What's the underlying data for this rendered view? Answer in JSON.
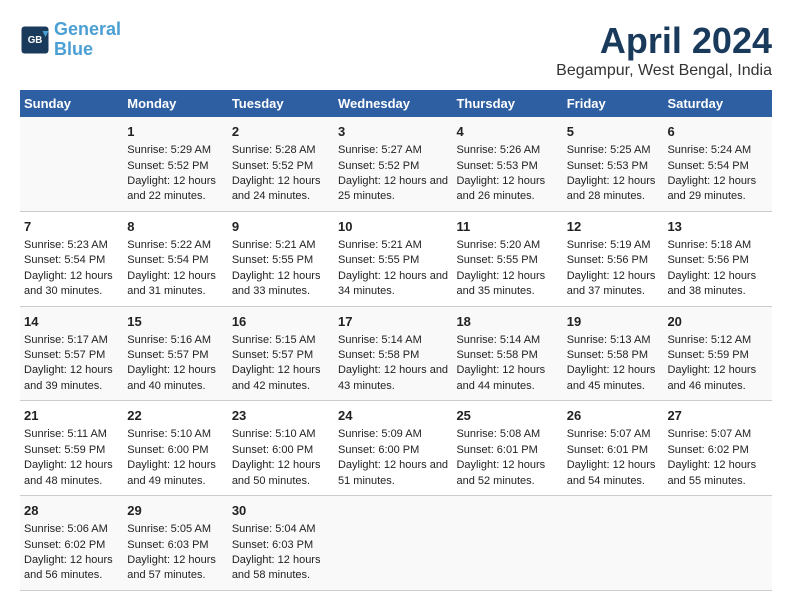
{
  "header": {
    "logo_line1": "General",
    "logo_line2": "Blue",
    "title": "April 2024",
    "subtitle": "Begampur, West Bengal, India"
  },
  "columns": [
    "Sunday",
    "Monday",
    "Tuesday",
    "Wednesday",
    "Thursday",
    "Friday",
    "Saturday"
  ],
  "weeks": [
    [
      {
        "day": "",
        "sunrise": "",
        "sunset": "",
        "daylight": ""
      },
      {
        "day": "1",
        "sunrise": "Sunrise: 5:29 AM",
        "sunset": "Sunset: 5:52 PM",
        "daylight": "Daylight: 12 hours and 22 minutes."
      },
      {
        "day": "2",
        "sunrise": "Sunrise: 5:28 AM",
        "sunset": "Sunset: 5:52 PM",
        "daylight": "Daylight: 12 hours and 24 minutes."
      },
      {
        "day": "3",
        "sunrise": "Sunrise: 5:27 AM",
        "sunset": "Sunset: 5:52 PM",
        "daylight": "Daylight: 12 hours and 25 minutes."
      },
      {
        "day": "4",
        "sunrise": "Sunrise: 5:26 AM",
        "sunset": "Sunset: 5:53 PM",
        "daylight": "Daylight: 12 hours and 26 minutes."
      },
      {
        "day": "5",
        "sunrise": "Sunrise: 5:25 AM",
        "sunset": "Sunset: 5:53 PM",
        "daylight": "Daylight: 12 hours and 28 minutes."
      },
      {
        "day": "6",
        "sunrise": "Sunrise: 5:24 AM",
        "sunset": "Sunset: 5:54 PM",
        "daylight": "Daylight: 12 hours and 29 minutes."
      }
    ],
    [
      {
        "day": "7",
        "sunrise": "Sunrise: 5:23 AM",
        "sunset": "Sunset: 5:54 PM",
        "daylight": "Daylight: 12 hours and 30 minutes."
      },
      {
        "day": "8",
        "sunrise": "Sunrise: 5:22 AM",
        "sunset": "Sunset: 5:54 PM",
        "daylight": "Daylight: 12 hours and 31 minutes."
      },
      {
        "day": "9",
        "sunrise": "Sunrise: 5:21 AM",
        "sunset": "Sunset: 5:55 PM",
        "daylight": "Daylight: 12 hours and 33 minutes."
      },
      {
        "day": "10",
        "sunrise": "Sunrise: 5:21 AM",
        "sunset": "Sunset: 5:55 PM",
        "daylight": "Daylight: 12 hours and 34 minutes."
      },
      {
        "day": "11",
        "sunrise": "Sunrise: 5:20 AM",
        "sunset": "Sunset: 5:55 PM",
        "daylight": "Daylight: 12 hours and 35 minutes."
      },
      {
        "day": "12",
        "sunrise": "Sunrise: 5:19 AM",
        "sunset": "Sunset: 5:56 PM",
        "daylight": "Daylight: 12 hours and 37 minutes."
      },
      {
        "day": "13",
        "sunrise": "Sunrise: 5:18 AM",
        "sunset": "Sunset: 5:56 PM",
        "daylight": "Daylight: 12 hours and 38 minutes."
      }
    ],
    [
      {
        "day": "14",
        "sunrise": "Sunrise: 5:17 AM",
        "sunset": "Sunset: 5:57 PM",
        "daylight": "Daylight: 12 hours and 39 minutes."
      },
      {
        "day": "15",
        "sunrise": "Sunrise: 5:16 AM",
        "sunset": "Sunset: 5:57 PM",
        "daylight": "Daylight: 12 hours and 40 minutes."
      },
      {
        "day": "16",
        "sunrise": "Sunrise: 5:15 AM",
        "sunset": "Sunset: 5:57 PM",
        "daylight": "Daylight: 12 hours and 42 minutes."
      },
      {
        "day": "17",
        "sunrise": "Sunrise: 5:14 AM",
        "sunset": "Sunset: 5:58 PM",
        "daylight": "Daylight: 12 hours and 43 minutes."
      },
      {
        "day": "18",
        "sunrise": "Sunrise: 5:14 AM",
        "sunset": "Sunset: 5:58 PM",
        "daylight": "Daylight: 12 hours and 44 minutes."
      },
      {
        "day": "19",
        "sunrise": "Sunrise: 5:13 AM",
        "sunset": "Sunset: 5:58 PM",
        "daylight": "Daylight: 12 hours and 45 minutes."
      },
      {
        "day": "20",
        "sunrise": "Sunrise: 5:12 AM",
        "sunset": "Sunset: 5:59 PM",
        "daylight": "Daylight: 12 hours and 46 minutes."
      }
    ],
    [
      {
        "day": "21",
        "sunrise": "Sunrise: 5:11 AM",
        "sunset": "Sunset: 5:59 PM",
        "daylight": "Daylight: 12 hours and 48 minutes."
      },
      {
        "day": "22",
        "sunrise": "Sunrise: 5:10 AM",
        "sunset": "Sunset: 6:00 PM",
        "daylight": "Daylight: 12 hours and 49 minutes."
      },
      {
        "day": "23",
        "sunrise": "Sunrise: 5:10 AM",
        "sunset": "Sunset: 6:00 PM",
        "daylight": "Daylight: 12 hours and 50 minutes."
      },
      {
        "day": "24",
        "sunrise": "Sunrise: 5:09 AM",
        "sunset": "Sunset: 6:00 PM",
        "daylight": "Daylight: 12 hours and 51 minutes."
      },
      {
        "day": "25",
        "sunrise": "Sunrise: 5:08 AM",
        "sunset": "Sunset: 6:01 PM",
        "daylight": "Daylight: 12 hours and 52 minutes."
      },
      {
        "day": "26",
        "sunrise": "Sunrise: 5:07 AM",
        "sunset": "Sunset: 6:01 PM",
        "daylight": "Daylight: 12 hours and 54 minutes."
      },
      {
        "day": "27",
        "sunrise": "Sunrise: 5:07 AM",
        "sunset": "Sunset: 6:02 PM",
        "daylight": "Daylight: 12 hours and 55 minutes."
      }
    ],
    [
      {
        "day": "28",
        "sunrise": "Sunrise: 5:06 AM",
        "sunset": "Sunset: 6:02 PM",
        "daylight": "Daylight: 12 hours and 56 minutes."
      },
      {
        "day": "29",
        "sunrise": "Sunrise: 5:05 AM",
        "sunset": "Sunset: 6:03 PM",
        "daylight": "Daylight: 12 hours and 57 minutes."
      },
      {
        "day": "30",
        "sunrise": "Sunrise: 5:04 AM",
        "sunset": "Sunset: 6:03 PM",
        "daylight": "Daylight: 12 hours and 58 minutes."
      },
      {
        "day": "",
        "sunrise": "",
        "sunset": "",
        "daylight": ""
      },
      {
        "day": "",
        "sunrise": "",
        "sunset": "",
        "daylight": ""
      },
      {
        "day": "",
        "sunrise": "",
        "sunset": "",
        "daylight": ""
      },
      {
        "day": "",
        "sunrise": "",
        "sunset": "",
        "daylight": ""
      }
    ]
  ]
}
